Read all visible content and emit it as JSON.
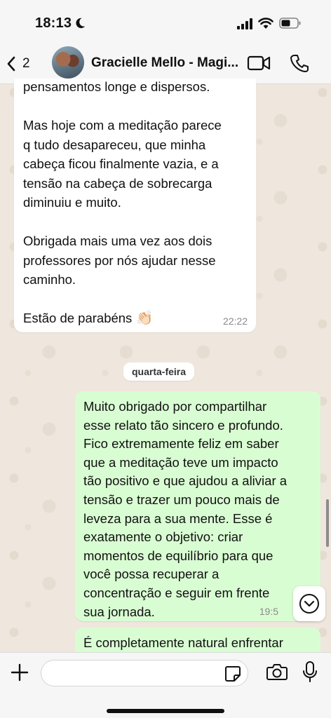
{
  "status_bar": {
    "time": "18:13"
  },
  "header": {
    "back_count": "2",
    "contact_name": "Gracielle Mello - Magi..."
  },
  "messages": {
    "incoming": {
      "text": "pensamentos longe e dispersos.\n\nMas hoje com a meditação parece\nq tudo desapareceu, que minha\ncabeça ficou finalmente vazia, e a\ntensão na cabeça de sobrecarga\ndiminuiu e muito.\n\nObrigada mais uma vez aos dois\nprofessores por nós ajudar nesse\ncaminho.\n\nEstão de parabéns",
      "emoji": "👏🏻",
      "time": "22:22"
    },
    "day_separator": "quarta-feira",
    "outgoing": {
      "text": "Muito obrigado por compartilhar\nesse relato tão sincero e profundo.\nFico extremamente feliz em saber\nque a meditação teve um impacto\ntão positivo e que ajudou a aliviar a\ntensão e trazer um pouco mais de\nleveza para a sua mente. Esse é\nexatamente o objetivo: criar\nmomentos de equilíbrio para que\nvocê possa recuperar a\nconcentração e seguir em frente\nsua jornada.",
      "time": "19:5"
    },
    "outgoing_2": {
      "text": "É completamente natural enfrentar"
    }
  },
  "input": {
    "value": "",
    "placeholder": ""
  },
  "icons": {
    "moon": "moon-icon",
    "signal": "cellular-signal-icon",
    "wifi": "wifi-icon",
    "battery": "battery-icon",
    "back": "chevron-left-icon",
    "video": "video-camera-icon",
    "phone": "phone-icon",
    "scroll_down": "chevron-down-circle-icon",
    "plus": "plus-icon",
    "sticker": "sticker-icon",
    "camera": "camera-icon",
    "mic": "microphone-icon"
  },
  "colors": {
    "outgoing_bubble": "#d9fdd3",
    "incoming_bubble": "#ffffff",
    "wallpaper": "#efe7dd",
    "bars": "#f6f6f6"
  }
}
